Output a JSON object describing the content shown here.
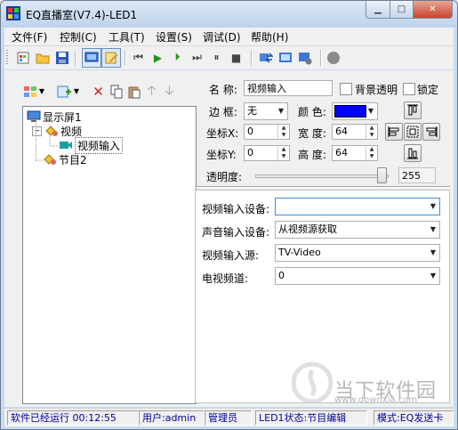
{
  "window": {
    "title": "EQ直播室(V7.4)-LED1"
  },
  "menu": [
    "文件(F)",
    "控制(C)",
    "工具(T)",
    "设置(S)",
    "调试(D)",
    "帮助(H)"
  ],
  "tree": {
    "root": "显示屏1",
    "program1": "视频",
    "item": "视频输入",
    "program2": "节目2"
  },
  "props": {
    "name_label": "名 称:",
    "name_value": "视频输入",
    "bg_transparent": "背景透明",
    "lock": "锁定",
    "border_label": "边 框:",
    "border_value": "无",
    "color_label": "颜 色:",
    "color_value": "#0000ff",
    "x_label": "坐标X:",
    "x_value": "0",
    "width_label": "宽 度:",
    "width_value": "64",
    "y_label": "坐标Y:",
    "y_value": "0",
    "height_label": "高 度:",
    "height_value": "64",
    "opacity_label": "透明度:",
    "opacity_value": "255",
    "opacity_fraction": 1.0
  },
  "video": {
    "device_label": "视频输入设备:",
    "device_value": "",
    "audio_label": "声音输入设备:",
    "audio_value": "从视频源获取",
    "source_label": "视频输入源:",
    "source_value": "TV-Video",
    "channel_label": "电视频道:",
    "channel_value": "0"
  },
  "status": {
    "running": "软件已经运行 00:12:55",
    "user": "用户:admin",
    "role": "管理员",
    "led": "LED1状态:节目编辑",
    "mode": "模式:EQ发送卡"
  },
  "watermark": {
    "text": "当下软件园",
    "url": "www.downxia.com"
  }
}
